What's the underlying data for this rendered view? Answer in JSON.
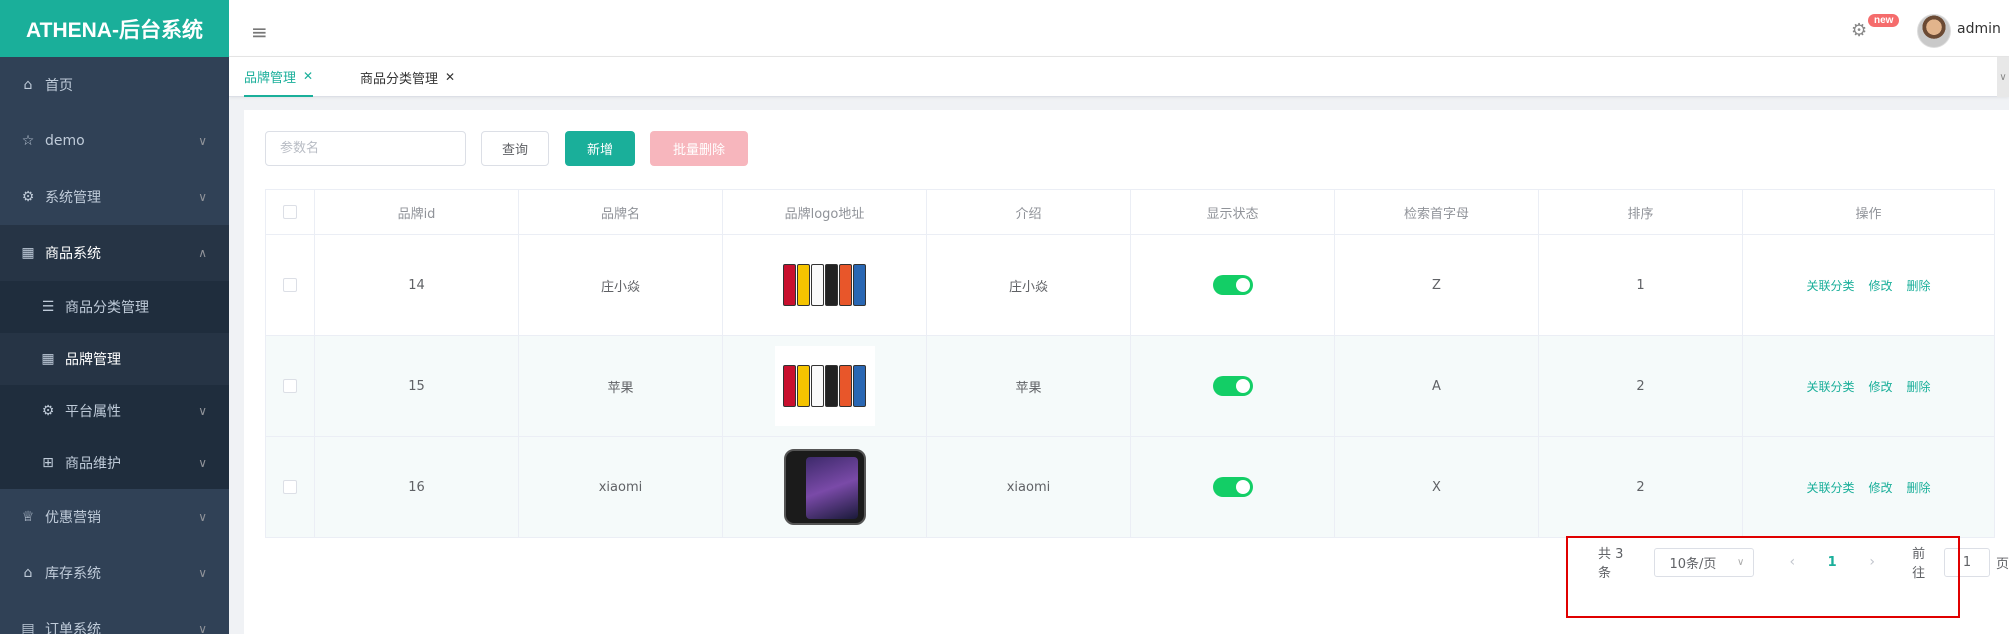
{
  "app": {
    "title": "ATHENA-后台系统"
  },
  "sidebar": {
    "items": [
      {
        "label": "首页",
        "icon": "home-icon"
      },
      {
        "label": "demo",
        "icon": "star-icon"
      },
      {
        "label": "系统管理",
        "icon": "gear-icon"
      },
      {
        "label": "商品系统",
        "icon": "grid-icon"
      },
      {
        "label": "优惠营销",
        "icon": "trophy-icon"
      },
      {
        "label": "库存系统",
        "icon": "home-icon"
      },
      {
        "label": "订单系统",
        "icon": "document-icon"
      }
    ],
    "subitems": [
      {
        "label": "商品分类管理",
        "icon": "list-icon"
      },
      {
        "label": "品牌管理",
        "icon": "grid-icon"
      },
      {
        "label": "平台属性",
        "icon": "gear-icon"
      },
      {
        "label": "商品维护",
        "icon": "apps-icon"
      }
    ]
  },
  "header": {
    "badge": "new",
    "username": "admin"
  },
  "tabs": [
    {
      "label": "品牌管理"
    },
    {
      "label": "商品分类管理"
    }
  ],
  "toolbar": {
    "search_placeholder": "参数名",
    "query_label": "查询",
    "add_label": "新增",
    "batch_delete_label": "批量删除"
  },
  "table": {
    "headers": [
      "品牌id",
      "品牌名",
      "品牌logo地址",
      "介绍",
      "显示状态",
      "检索首字母",
      "排序",
      "操作"
    ],
    "rows": [
      {
        "id": "14",
        "name": "庄小焱",
        "intro": "庄小焱",
        "status": true,
        "letter": "Z",
        "sort": "1"
      },
      {
        "id": "15",
        "name": "苹果",
        "intro": "苹果",
        "status": true,
        "letter": "A",
        "sort": "2"
      },
      {
        "id": "16",
        "name": "xiaomi",
        "intro": "xiaomi",
        "status": true,
        "letter": "X",
        "sort": "2"
      }
    ],
    "actions": {
      "relate": "关联分类",
      "edit": "修改",
      "delete": "删除"
    }
  },
  "pagination": {
    "total": "共 3 条",
    "page_size": "10条/页",
    "current": "1",
    "goto_label": "前往",
    "goto_value": "1",
    "page_suffix": "页"
  },
  "colors": {
    "accent": "#1aaf9a",
    "sidebar": "#304156",
    "switch_on": "#13ce66",
    "highlight_box": "#e00000"
  }
}
